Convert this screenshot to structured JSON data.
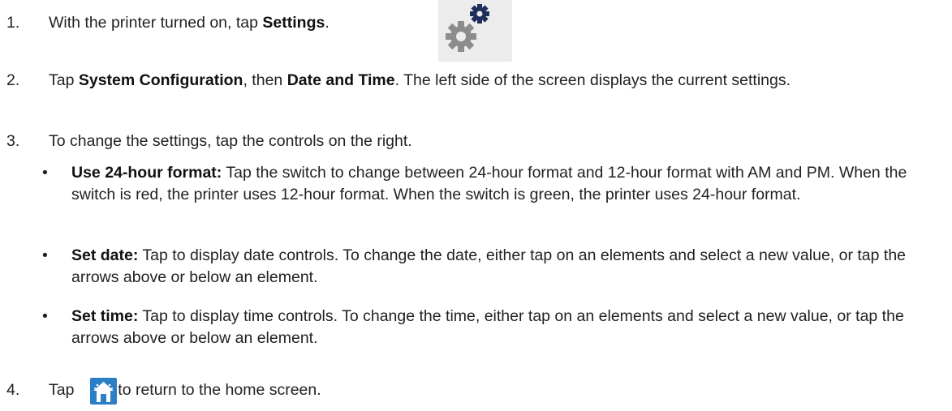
{
  "steps": [
    {
      "num": "1.",
      "pre": "With the printer turned on, tap ",
      "bold": "Settings",
      "post": "."
    },
    {
      "num": "2.",
      "pre": "Tap ",
      "bold1": "System Configuration",
      "mid": ", then ",
      "bold2": "Date and Time",
      "post": ". The left side of the screen displays the current settings."
    },
    {
      "num": "3.",
      "text": "To change the settings, tap the controls on the right."
    },
    {
      "num": "4.",
      "pre": "Tap ",
      "post": " to return to the home screen."
    }
  ],
  "bullets": [
    {
      "mark": "•",
      "term": "Use 24-hour format:",
      "text": " Tap the switch to change between 24-hour format and 12-hour format with AM and PM. When the switch is red, the printer uses 12-hour format. When the switch is green, the printer uses 24-hour format."
    },
    {
      "mark": "•",
      "term": "Set date:",
      "text": " Tap to display date controls. To change the date, either tap on an elements and select a new value, or tap the arrows above or below an element."
    },
    {
      "mark": "•",
      "term": "Set time:",
      "text": " Tap to display time controls. To change the time, either tap on an elements and select a new value, or tap the arrows above or below an element."
    }
  ],
  "icons": {
    "settings": "settings-gears-icon",
    "home": "home-icon",
    "colors": {
      "gear_dark": "#1f2f5c",
      "gear_grey": "#8c8c8c",
      "icon_bg": "#ececec",
      "home_bg": "#2a7fc6"
    }
  }
}
